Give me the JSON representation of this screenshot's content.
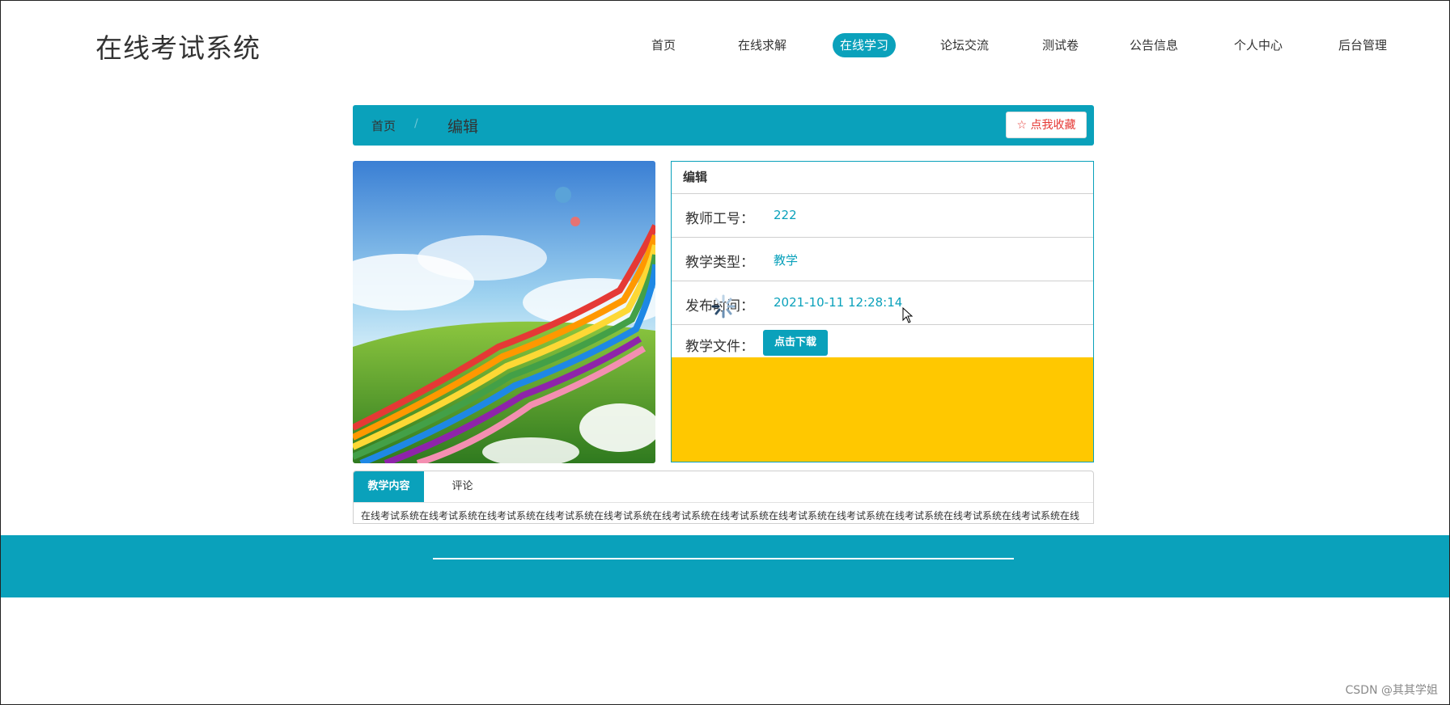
{
  "site": {
    "title": "在线考试系统"
  },
  "nav": {
    "items": [
      {
        "label": "首页",
        "active": false
      },
      {
        "label": "在线求解",
        "active": false
      },
      {
        "label": "在线学习",
        "active": true
      },
      {
        "label": "论坛交流",
        "active": false
      },
      {
        "label": "测试卷",
        "active": false
      },
      {
        "label": "公告信息",
        "active": false
      },
      {
        "label": "个人中心",
        "active": false
      },
      {
        "label": "后台管理",
        "active": false
      }
    ]
  },
  "breadcrumb": {
    "home": "首页",
    "separator": "/",
    "current": "编辑",
    "favorite_label": "☆ 点我收藏"
  },
  "detail": {
    "heading": "编辑",
    "rows": [
      {
        "label": "教师工号：",
        "value": "222"
      },
      {
        "label": "教学类型：",
        "value": "教学"
      },
      {
        "label": "发布时间：",
        "value": "2021-10-11 12:28:14"
      }
    ],
    "file_label": "教学文件：",
    "download_label": "点击下载"
  },
  "tabs": {
    "items": [
      {
        "label": "教学内容",
        "active": true
      },
      {
        "label": "评论",
        "active": false
      }
    ],
    "content": "在线考试系统在线考试系统在线考试系统在线考试系统在线考试系统在线考试系统在线考试系统在线考试系统在线考试系统在线考试系统在线考试系统在线考试系统在线"
  },
  "watermark": "CSDN @其其学姐",
  "colors": {
    "accent": "#0aa1bb",
    "favorite": "#e53935",
    "yellow": "#ffc800"
  }
}
